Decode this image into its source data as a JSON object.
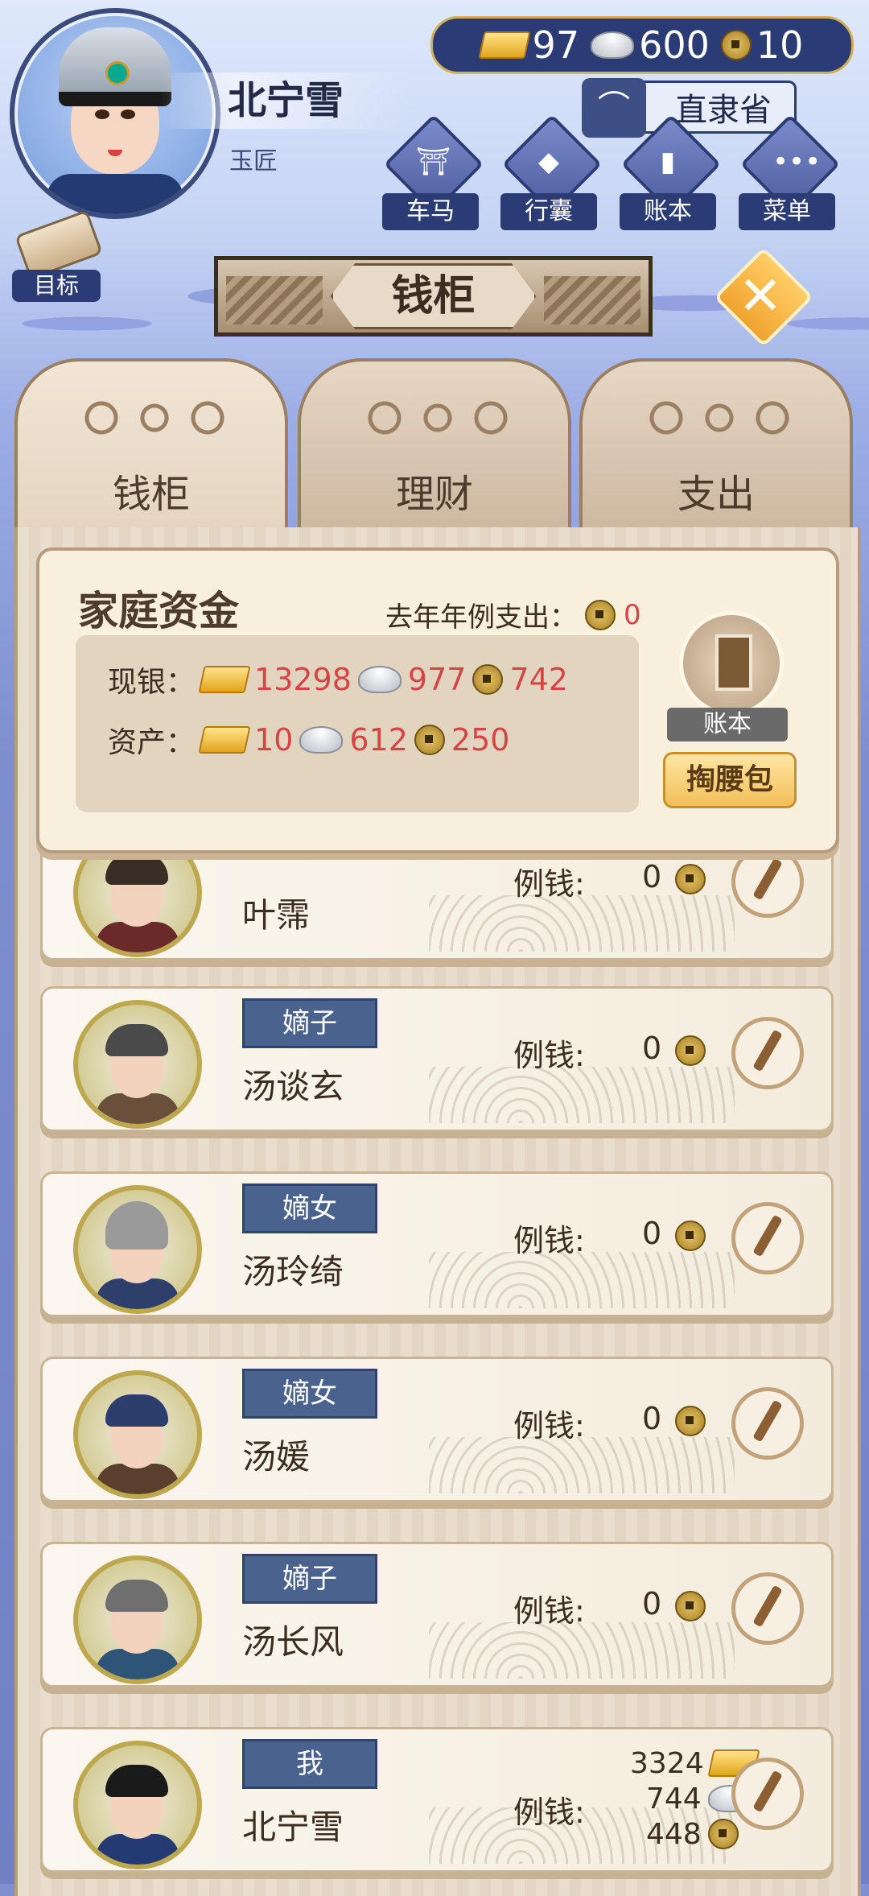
{
  "hud": {
    "player_name": "北宁雪",
    "player_title": "玉匠",
    "gold": "97",
    "silver": "600",
    "coins": "10",
    "province": "直隶省",
    "quick_buttons": [
      {
        "label": "车马",
        "icon": "carriage-icon"
      },
      {
        "label": "行囊",
        "icon": "bag-icon"
      },
      {
        "label": "账本",
        "icon": "ledger-icon"
      },
      {
        "label": "菜单",
        "icon": "menu-dots-icon"
      }
    ],
    "goal_label": "目标"
  },
  "page_title": "钱柜",
  "tabs": [
    {
      "label": "钱柜",
      "active": true
    },
    {
      "label": "理财",
      "active": false
    },
    {
      "label": "支出",
      "active": false
    }
  ],
  "family_funds": {
    "title": "家庭资金",
    "last_year_label": "去年年例支出：",
    "last_year_value": "0",
    "cash_label": "现银：",
    "cash_gold": "13298",
    "cash_silver": "977",
    "cash_coins": "742",
    "assets_label": "资产：",
    "assets_gold": "10",
    "assets_silver": "612",
    "assets_coins": "250",
    "ledger_label": "账本",
    "pocket_label": "掏腰包"
  },
  "allowance_label": "例钱:",
  "members": [
    {
      "tag": "",
      "name": "叶霈",
      "allowance": "0"
    },
    {
      "tag": "嫡子",
      "name": "汤谈玄",
      "allowance": "0"
    },
    {
      "tag": "嫡女",
      "name": "汤玲绮",
      "allowance": "0"
    },
    {
      "tag": "嫡女",
      "name": "汤媛",
      "allowance": "0"
    },
    {
      "tag": "嫡子",
      "name": "汤长风",
      "allowance": "0"
    }
  ],
  "me": {
    "tag": "我",
    "name": "北宁雪",
    "gold": "3324",
    "silver": "744",
    "coins": "448"
  }
}
